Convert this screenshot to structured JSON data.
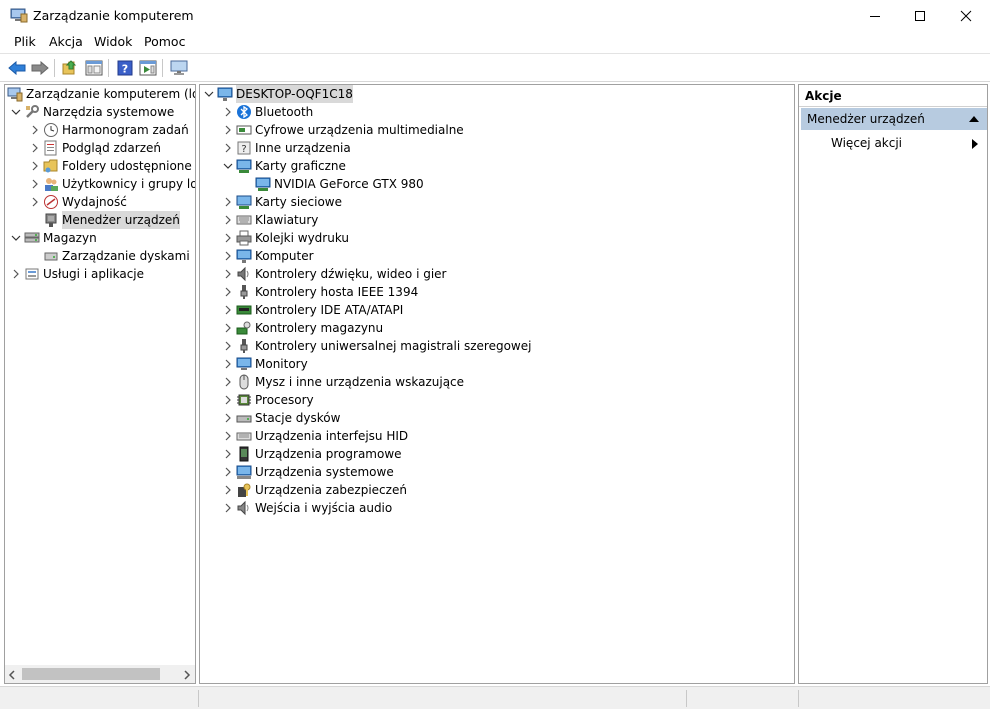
{
  "window": {
    "title": "Zarządzanie komputerem",
    "controls": [
      "minimize",
      "maximize",
      "close"
    ]
  },
  "menu": [
    {
      "label": "Plik"
    },
    {
      "label": "Akcja"
    },
    {
      "label": "Widok"
    },
    {
      "label": "Pomoc"
    }
  ],
  "toolbar": {
    "buttons": [
      "back-icon",
      "forward-icon",
      "up-folder-icon",
      "show-hide-tree-icon",
      "help-icon",
      "properties-pane-icon",
      "monitor-icon"
    ]
  },
  "left_tree": {
    "root": "Zarządzanie komputerem (lokalny)",
    "items": [
      {
        "label": "Narzędzia systemowe",
        "icon": "tools-icon",
        "expanded": true
      },
      {
        "label": "Harmonogram zadań",
        "icon": "clock-icon"
      },
      {
        "label": "Podgląd zdarzeń",
        "icon": "event-viewer-icon"
      },
      {
        "label": "Foldery udostępnione",
        "icon": "shared-folder-icon"
      },
      {
        "label": "Użytkownicy i grupy lokalne",
        "icon": "users-icon"
      },
      {
        "label": "Wydajność",
        "icon": "performance-icon"
      },
      {
        "label": "Menedżer urządzeń",
        "icon": "device-manager-icon",
        "selected": true
      },
      {
        "label": "Magazyn",
        "icon": "storage-icon",
        "expanded": true
      },
      {
        "label": "Zarządzanie dyskami",
        "icon": "disk-management-icon"
      },
      {
        "label": "Usługi i aplikacje",
        "icon": "services-icon",
        "expanded": false
      }
    ]
  },
  "device_tree": {
    "computer": "DESKTOP-OQF1C18",
    "categories": [
      {
        "label": "Bluetooth",
        "icon": "bluetooth-icon"
      },
      {
        "label": "Cyfrowe urządzenia multimedialne",
        "icon": "media-device-icon"
      },
      {
        "label": "Inne urządzenia",
        "icon": "unknown-device-icon"
      },
      {
        "label": "Karty graficzne",
        "icon": "display-adapter-icon",
        "expanded": true,
        "children": [
          "NVIDIA GeForce GTX 980"
        ]
      },
      {
        "label": "Karty sieciowe",
        "icon": "network-adapter-icon"
      },
      {
        "label": "Klawiatury",
        "icon": "keyboard-icon"
      },
      {
        "label": "Kolejki wydruku",
        "icon": "printer-icon"
      },
      {
        "label": "Komputer",
        "icon": "computer-icon"
      },
      {
        "label": "Kontrolery dźwięku, wideo i gier",
        "icon": "speaker-icon"
      },
      {
        "label": "Kontrolery hosta IEEE 1394",
        "icon": "ieee1394-icon"
      },
      {
        "label": "Kontrolery IDE ATA/ATAPI",
        "icon": "ide-controller-icon"
      },
      {
        "label": "Kontrolery magazynu",
        "icon": "storage-controller-icon"
      },
      {
        "label": "Kontrolery uniwersalnej magistrali szeregowej",
        "icon": "usb-icon"
      },
      {
        "label": "Monitory",
        "icon": "monitor-icon"
      },
      {
        "label": "Mysz i inne urządzenia wskazujące",
        "icon": "mouse-icon"
      },
      {
        "label": "Procesory",
        "icon": "processor-icon"
      },
      {
        "label": "Stacje dysków",
        "icon": "disk-drive-icon"
      },
      {
        "label": "Urządzenia interfejsu HID",
        "icon": "hid-icon"
      },
      {
        "label": "Urządzenia programowe",
        "icon": "software-device-icon"
      },
      {
        "label": "Urządzenia systemowe",
        "icon": "system-device-icon"
      },
      {
        "label": "Urządzenia zabezpieczeń",
        "icon": "security-device-icon"
      },
      {
        "label": "Wejścia i wyjścia audio",
        "icon": "audio-io-icon"
      }
    ]
  },
  "actions": {
    "header": "Akcje",
    "section": "Menedżer urządzeń",
    "more": "Więcej akcji"
  },
  "colors": {
    "selection": "#d9d9d9",
    "action_section": "#b7cbe0",
    "chrome": "#f0f0f0",
    "border": "#a0a0a0"
  }
}
